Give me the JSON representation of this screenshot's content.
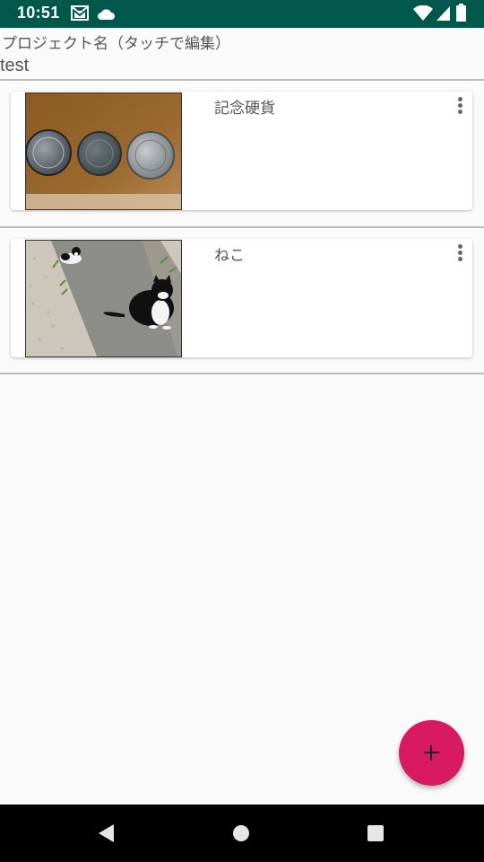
{
  "status_bar": {
    "time": "10:51",
    "icons": [
      "gmail-icon",
      "cloud-icon",
      "wifi-icon",
      "signal-icon",
      "battery-icon"
    ]
  },
  "header": {
    "project_label": "プロジェクト名（タッチで編集）",
    "project_name": "test"
  },
  "items": [
    {
      "title": "記念硬貨",
      "image": "coins-photo"
    },
    {
      "title": "ねこ",
      "image": "cat-photo"
    }
  ],
  "fab": {
    "icon": "plus-icon",
    "color": "#d81b60"
  },
  "nav_bar": {
    "buttons": [
      "back-icon",
      "home-icon",
      "recents-icon"
    ]
  },
  "colors": {
    "status_bar": "#00574b",
    "accent": "#d81b60"
  }
}
